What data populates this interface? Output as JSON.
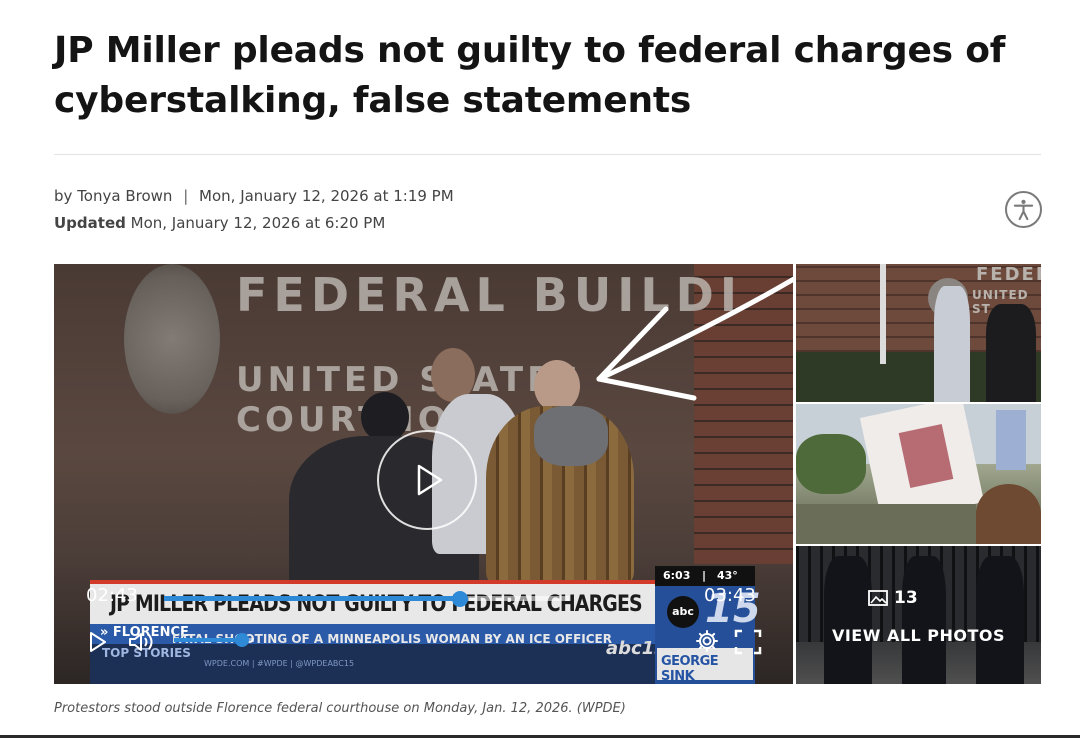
{
  "article": {
    "headline": "JP Miller pleads not guilty to federal charges of cyberstalking, false statements",
    "byline": {
      "prefix": "by",
      "author": "Tonya Brown",
      "separator": "|",
      "published": "Mon, January 12, 2026 at 1:19 PM"
    },
    "updated": {
      "label": "Updated",
      "date": "Mon, January 12, 2026 at 6:20 PM"
    },
    "caption": "Protestors stood outside Florence federal courthouse on Monday, Jan. 12, 2026. (WPDE)"
  },
  "video": {
    "building_text_1": "FEDERAL BUILDI",
    "building_text_2": "UNITED STATES COURTHO",
    "lower_third": {
      "headline": "JP MILLER PLEADS NOT GUILTY TO FEDERAL CHARGES",
      "location": "» FLORENCE",
      "ticker": "FATAL SHOOTING OF A MINNEAPOLIS WOMAN BY AN ICE OFFICER",
      "section": "TOP STORIES",
      "web": "WPDE.COM | #WPDE | @WPDEABC15",
      "station_tag": "abc15"
    },
    "weather": {
      "time": "6:03",
      "separator": "|",
      "temp": "43°"
    },
    "station_logo": {
      "network": "abc",
      "channel": "15",
      "sponsor": "GEORGE SINK"
    },
    "player": {
      "current_time": "02:43",
      "duration": "03:43",
      "progress_fraction": 0.73,
      "volume_fraction": 0.85
    }
  },
  "gallery": {
    "photo_count": "13",
    "view_all_label": "VIEW ALL PHOTOS"
  },
  "icons": {
    "accessibility": "accessibility-icon",
    "play_overlay": "play-icon",
    "play": "play-icon",
    "volume": "volume-icon",
    "settings": "gear-icon",
    "fullscreen": "fullscreen-icon",
    "gallery": "image-icon"
  },
  "colors": {
    "progress": "#2e8ad6",
    "lower_third_red": "#d23a2a",
    "lower_third_blue": "#2b5aa8"
  }
}
